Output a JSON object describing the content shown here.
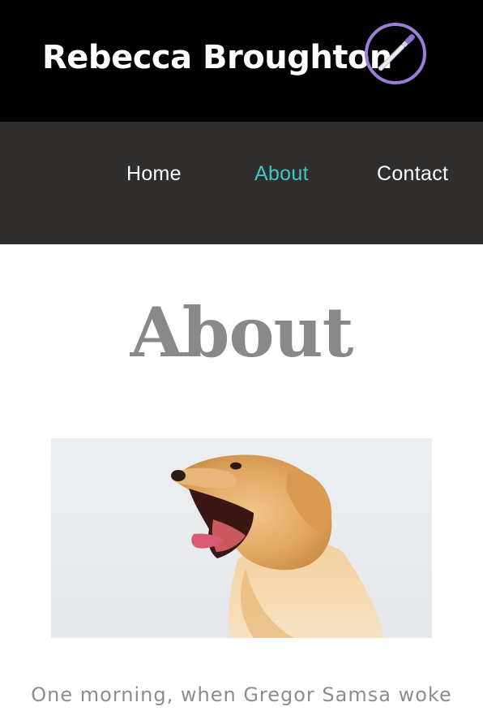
{
  "header": {
    "site_title": "Rebecca Broughton",
    "logo_icon": "paintbrush-icon",
    "background": "#000000",
    "logo_color": "#9b7fd6"
  },
  "nav": {
    "background": "#302d2d",
    "items": [
      {
        "label": "Home",
        "active": false
      },
      {
        "label": "About",
        "active": true
      },
      {
        "label": "Contact",
        "active": false
      }
    ],
    "active_color": "#3fc6c2",
    "text_color": "#ffffff"
  },
  "main": {
    "page_title": "About",
    "photo_subject": "dog-photo",
    "body_text": "One morning, when Gregor Samsa woke"
  }
}
